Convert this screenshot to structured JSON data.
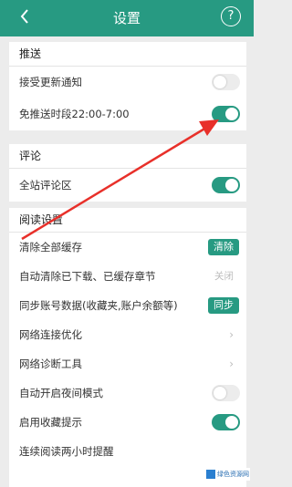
{
  "header": {
    "back_icon": "chevron-left-icon",
    "title": "设置",
    "help_label": "?"
  },
  "sections": {
    "push": {
      "title": "推送",
      "rows": [
        {
          "label": "接受更新通知",
          "control": "toggle",
          "on": false
        },
        {
          "label": "免推送时段22:00-7:00",
          "control": "toggle",
          "on": true
        }
      ]
    },
    "comment": {
      "title": "评论",
      "rows": [
        {
          "label": "全站评论区",
          "control": "toggle",
          "on": true
        }
      ]
    },
    "reading": {
      "title": "阅读设置",
      "rows": [
        {
          "label": "清除全部缓存",
          "control": "button",
          "button_label": "清除"
        },
        {
          "label": "自动清除已下载、已缓存章节",
          "control": "status",
          "status": "关闭"
        },
        {
          "label": "同步账号数据(收藏夹,账户余额等)",
          "control": "button",
          "button_label": "同步"
        },
        {
          "label": "网络连接优化",
          "control": "arrow"
        },
        {
          "label": "网络诊断工具",
          "control": "arrow"
        },
        {
          "label": "自动开启夜间模式",
          "control": "toggle",
          "on": false
        },
        {
          "label": "启用收藏提示",
          "control": "toggle",
          "on": true
        },
        {
          "label": "连续阅读两小时提醒",
          "control": "arrow"
        }
      ]
    }
  },
  "watermark": {
    "text": "绿色资源网"
  },
  "colors": {
    "accent": "#279a82",
    "annotation": "#e8302a",
    "background": "#ececec"
  }
}
